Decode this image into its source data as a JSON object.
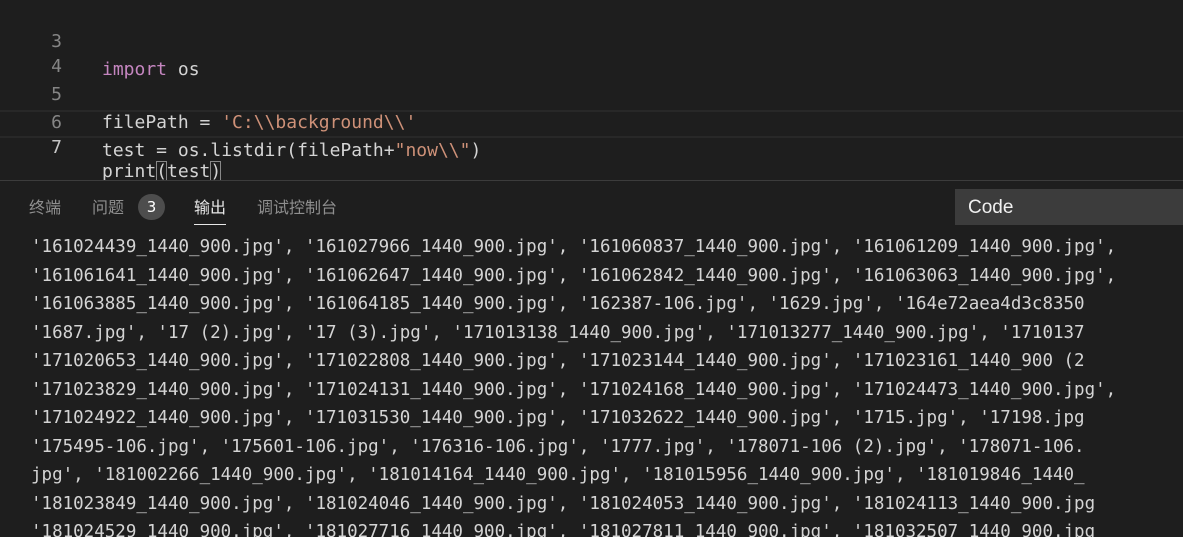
{
  "editor": {
    "lines": [
      {
        "number": "3",
        "segments": [
          {
            "text": "import",
            "kind": "kw"
          },
          {
            "text": " os",
            "kind": "plain"
          }
        ]
      },
      {
        "number": "4",
        "segments": []
      },
      {
        "number": "5",
        "segments": [
          {
            "text": "filePath = ",
            "kind": "plain"
          },
          {
            "text": "'C:\\\\background\\\\'",
            "kind": "str"
          }
        ]
      },
      {
        "number": "6",
        "segments": [
          {
            "text": "test = os.listdir(filePath+",
            "kind": "plain"
          },
          {
            "text": "\"now\\\\\"",
            "kind": "str"
          },
          {
            "text": ")",
            "kind": "plain"
          }
        ]
      },
      {
        "number": "7",
        "segments": [
          {
            "text": "print",
            "kind": "plain"
          },
          {
            "text": "(",
            "kind": "bracket"
          },
          {
            "text": "test",
            "kind": "plain"
          },
          {
            "text": ")",
            "kind": "bracket"
          }
        ],
        "current": true
      }
    ]
  },
  "panel": {
    "tabs": [
      {
        "label": "终端",
        "active": false
      },
      {
        "label": "问题",
        "active": false,
        "badge": "3"
      },
      {
        "label": "输出",
        "active": true
      },
      {
        "label": "调试控制台",
        "active": false
      }
    ],
    "output_channel": "Code",
    "output_lines": [
      "'161024439_1440_900.jpg', '161027966_1440_900.jpg', '161060837_1440_900.jpg', '161061209_1440_900.jpg',",
      "'161061641_1440_900.jpg', '161062647_1440_900.jpg', '161062842_1440_900.jpg', '161063063_1440_900.jpg',",
      "'161063885_1440_900.jpg', '161064185_1440_900.jpg', '162387-106.jpg', '1629.jpg', '164e72aea4d3c8350",
      "'1687.jpg', '17 (2).jpg', '17 (3).jpg', '171013138_1440_900.jpg', '171013277_1440_900.jpg', '1710137",
      "'171020653_1440_900.jpg', '171022808_1440_900.jpg', '171023144_1440_900.jpg', '171023161_1440_900 (2",
      "'171023829_1440_900.jpg', '171024131_1440_900.jpg', '171024168_1440_900.jpg', '171024473_1440_900.jpg',",
      "'171024922_1440_900.jpg', '171031530_1440_900.jpg', '171032622_1440_900.jpg', '1715.jpg', '17198.jpg",
      "'175495-106.jpg', '175601-106.jpg', '176316-106.jpg', '1777.jpg', '178071-106 (2).jpg', '178071-106.",
      "jpg', '181002266_1440_900.jpg', '181014164_1440_900.jpg', '181015956_1440_900.jpg', '181019846_1440_",
      "'181023849_1440_900.jpg', '181024046_1440_900.jpg', '181024053_1440_900.jpg', '181024113_1440_900.jpg",
      "'181024529_1440_900.jpg', '181027716_1440_900.jpg', '181027811_1440_900.jpg', '181032507_1440_900.jpg"
    ]
  },
  "colors": {
    "background": "#1e1e1e",
    "keyword": "#c586c0",
    "string": "#ce9178",
    "text": "#d4d4d4",
    "line_number": "#858585",
    "dropdown_bg": "#3c3c3c"
  }
}
